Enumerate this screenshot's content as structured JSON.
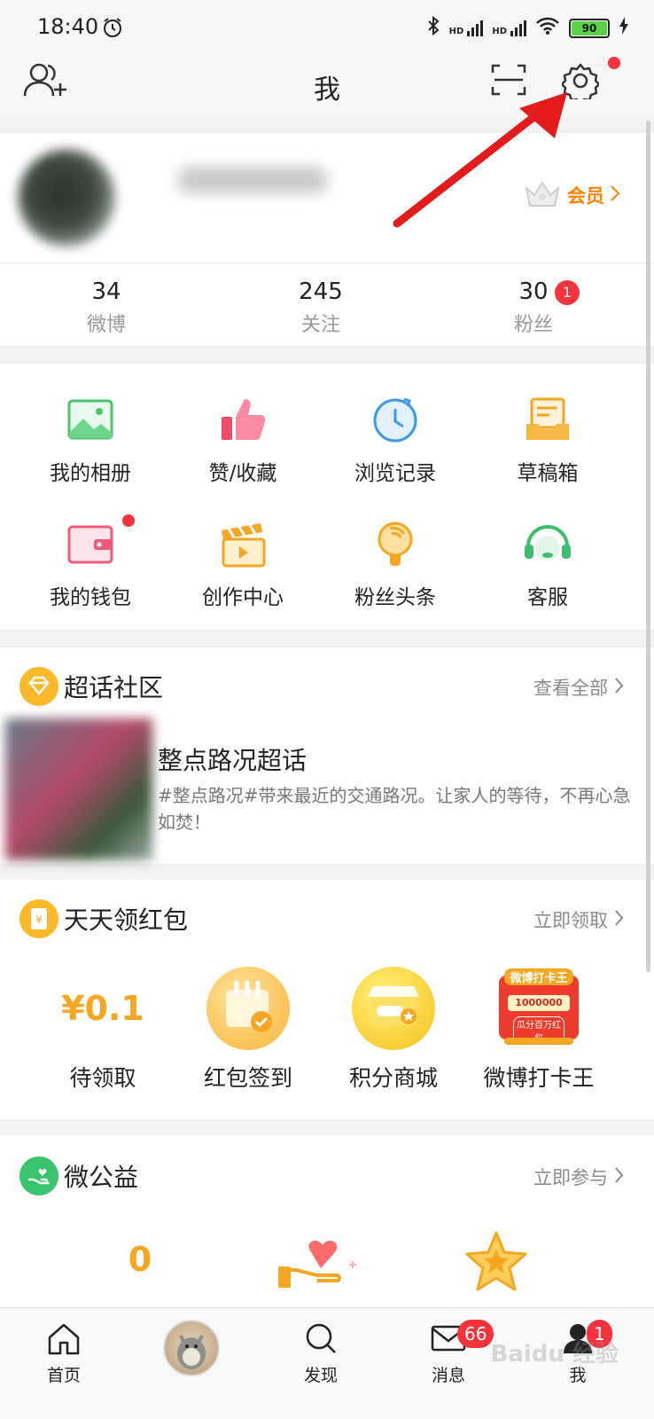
{
  "status_bar": {
    "time": "18:40",
    "net1": "HD",
    "net2": "HD",
    "battery": "90"
  },
  "header": {
    "title": "我"
  },
  "profile": {
    "vip_label": "会员"
  },
  "stats": [
    {
      "num": "34",
      "label": "微博"
    },
    {
      "num": "245",
      "label": "关注"
    },
    {
      "num": "30",
      "label": "粉丝",
      "badge": "1"
    }
  ],
  "grid": [
    {
      "label": "我的相册",
      "icon": "photo-album-icon"
    },
    {
      "label": "赞/收藏",
      "icon": "thumbs-up-icon"
    },
    {
      "label": "浏览记录",
      "icon": "history-clock-icon"
    },
    {
      "label": "草稿箱",
      "icon": "drafts-tray-icon"
    },
    {
      "label": "我的钱包",
      "icon": "wallet-icon"
    },
    {
      "label": "创作中心",
      "icon": "clapperboard-icon"
    },
    {
      "label": "粉丝头条",
      "icon": "lightbulb-icon"
    },
    {
      "label": "客服",
      "icon": "headset-icon"
    }
  ],
  "supertopic": {
    "title": "超话社区",
    "link": "查看全部",
    "topic_title": "整点路况超话",
    "topic_desc": "#整点路况#带来最近的交通路况。让家人的等待，不再心急如焚！"
  },
  "redpacket": {
    "title": "天天领红包",
    "link": "立即领取",
    "amount": "¥0.1",
    "items": [
      {
        "label": "待领取"
      },
      {
        "label": "红包签到"
      },
      {
        "label": "积分商城"
      },
      {
        "label": "微博打卡王"
      }
    ],
    "card_text": "微博打卡王",
    "card_num": "1000000",
    "card_sub": "瓜分百万红包"
  },
  "charity": {
    "title": "微公益",
    "link": "立即参与",
    "value": "0"
  },
  "nav": [
    {
      "label": "首页"
    },
    {
      "label": ""
    },
    {
      "label": "发现"
    },
    {
      "label": "消息",
      "badge": "66"
    },
    {
      "label": "我",
      "badge": "1"
    }
  ],
  "colors": {
    "accent": "#ff8200",
    "badge": "#f4333c",
    "gold": "#f7a823"
  },
  "watermark": "Baidu 经验"
}
